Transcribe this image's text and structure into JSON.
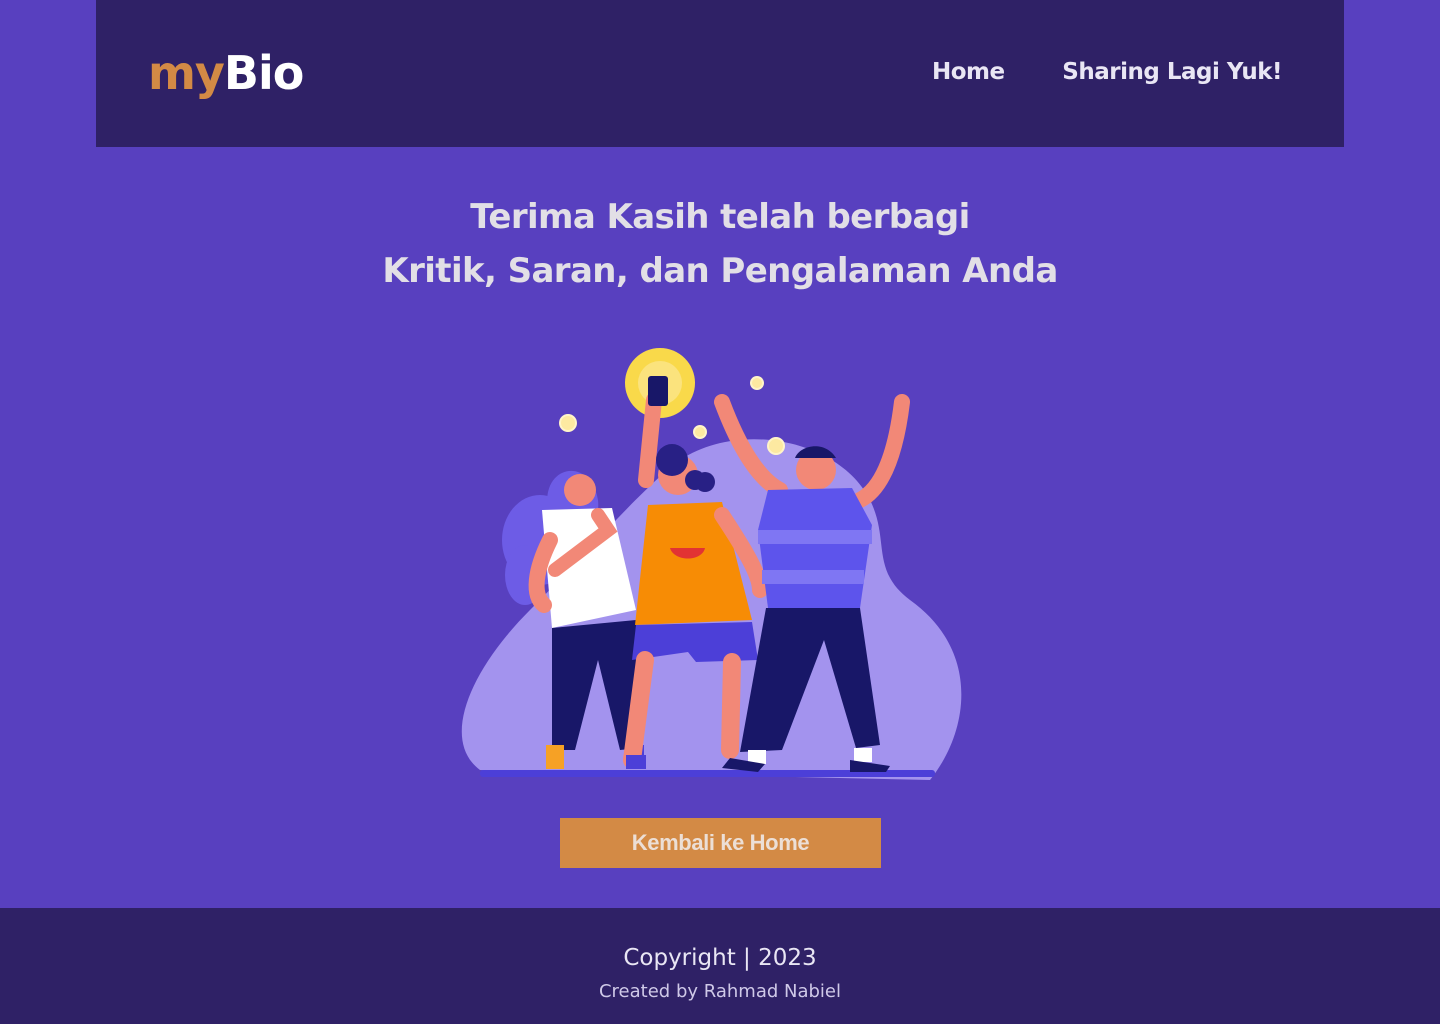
{
  "header": {
    "logo_my": "my",
    "logo_bio": "Bio",
    "nav": [
      {
        "label": "Home"
      },
      {
        "label": "Sharing Lagi Yuk!"
      }
    ]
  },
  "main": {
    "heading_line1": "Terima Kasih telah berbagi",
    "heading_line2": "Kritik, Saran, dan Pengalaman Anda",
    "illustration_icon": "celebrating-people-illustration",
    "button_label": "Kembali ke Home"
  },
  "footer": {
    "copyright": "Copyright | 2023",
    "credit": "Created by Rahmad Nabiel"
  },
  "colors": {
    "background": "#5840bf",
    "navbar": "#2f2166",
    "accent": "#d38a45",
    "text_light": "#e2dfe6"
  }
}
